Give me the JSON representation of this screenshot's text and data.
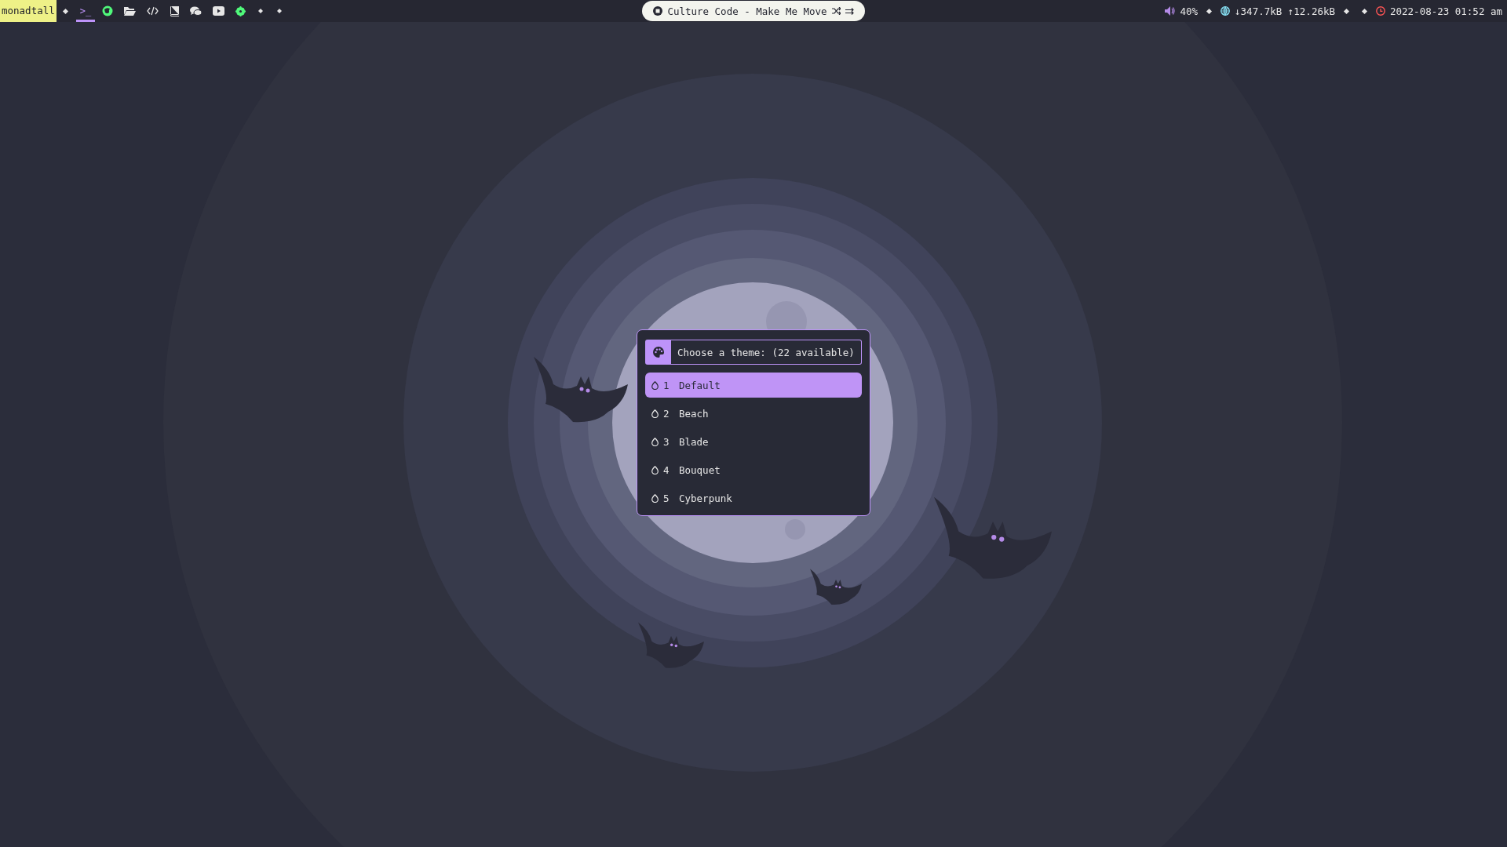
{
  "bar": {
    "layout_name": "monadtall",
    "workspaces": [
      {
        "kind": "terminal",
        "label": ">_",
        "selected": true
      },
      {
        "kind": "browser",
        "selected": false
      },
      {
        "kind": "folder",
        "selected": false
      },
      {
        "kind": "code",
        "selected": false
      },
      {
        "kind": "book",
        "selected": false
      },
      {
        "kind": "chat",
        "selected": false
      },
      {
        "kind": "video",
        "selected": false
      },
      {
        "kind": "gear",
        "selected": false
      },
      {
        "kind": "empty",
        "selected": false
      },
      {
        "kind": "empty",
        "selected": false
      }
    ],
    "window_title": "Culture Code - Make Me Move",
    "volume": "40%",
    "network": "↓347.7kB ↑12.26kB",
    "clock": "2022-08-23 01:52 am"
  },
  "launcher": {
    "prompt": "Choose a theme: (22 available)",
    "items": [
      {
        "number": "1",
        "label": "Default",
        "selected": true
      },
      {
        "number": "2",
        "label": "Beach",
        "selected": false
      },
      {
        "number": "3",
        "label": "Blade",
        "selected": false
      },
      {
        "number": "4",
        "label": "Bouquet",
        "selected": false
      },
      {
        "number": "5",
        "label": "Cyberpunk",
        "selected": false
      }
    ]
  }
}
